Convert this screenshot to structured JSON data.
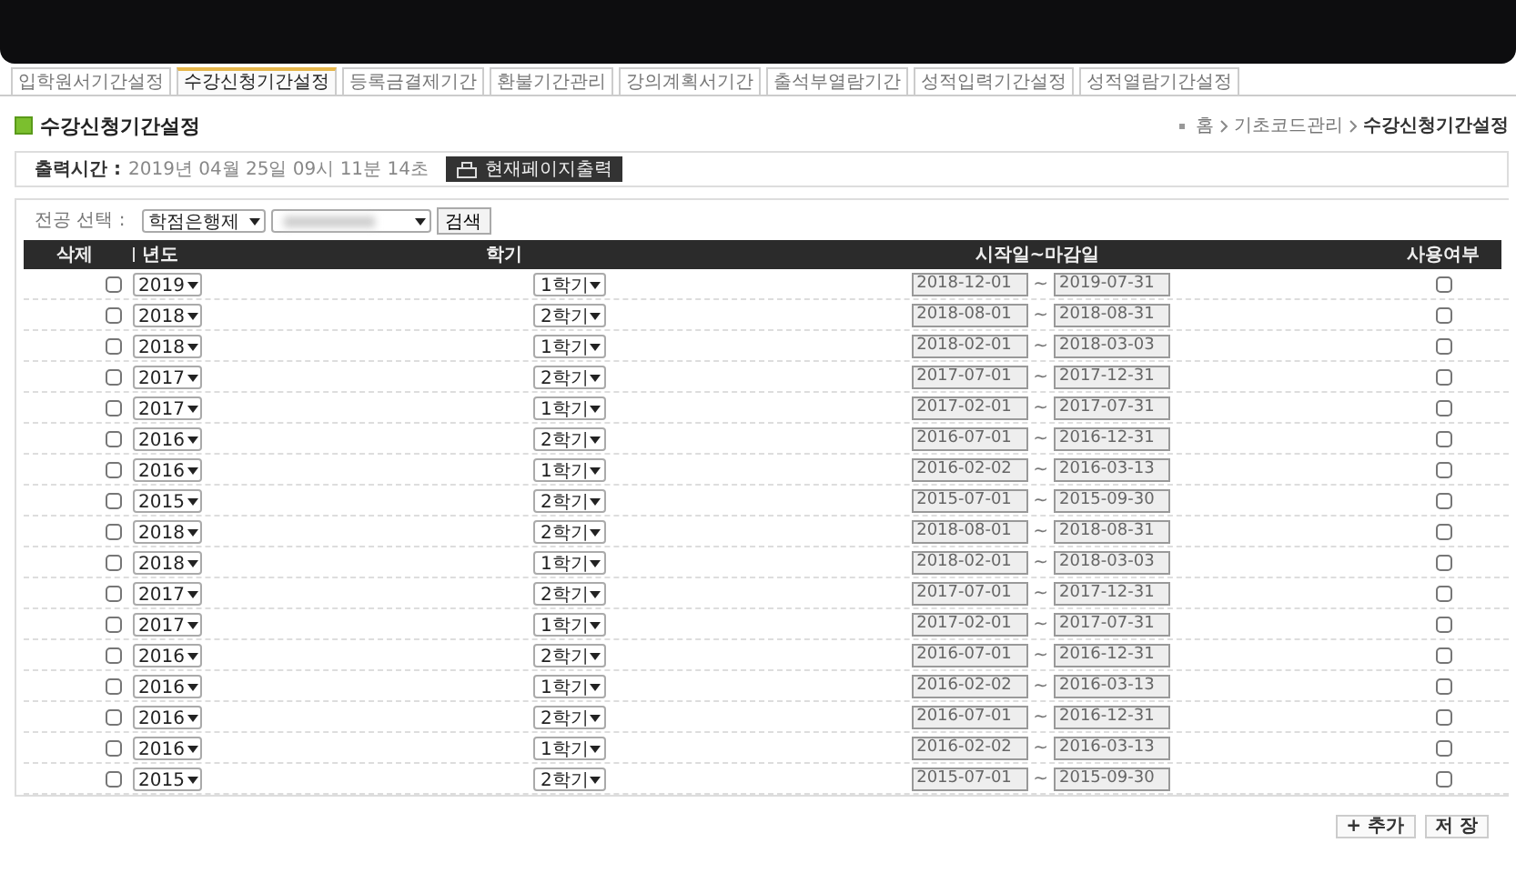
{
  "tabs": [
    {
      "label": "입학원서기간설정",
      "selected": false
    },
    {
      "label": "수강신청기간설정",
      "selected": true
    },
    {
      "label": "등록금결제기간",
      "selected": false
    },
    {
      "label": "환불기간관리",
      "selected": false
    },
    {
      "label": "강의계획서기간",
      "selected": false
    },
    {
      "label": "출석부열람기간",
      "selected": false
    },
    {
      "label": "성적입력기간설정",
      "selected": false
    },
    {
      "label": "성적열람기간설정",
      "selected": false
    }
  ],
  "page_title": "수강신청기간설정",
  "breadcrumb": [
    "홈",
    "기초코드관리",
    "수강신청기간설정"
  ],
  "print_info": {
    "label": "출력시간 :",
    "value": "2019년 04월 25일 09시 11분 14초",
    "button": "현재페이지출력"
  },
  "filter": {
    "label": "전공 선택 :",
    "major_select": "학점은행제",
    "detail_select": {
      "redacted": true
    },
    "search_button": "검색"
  },
  "table": {
    "columns": [
      "삭제",
      "년도",
      "학기",
      "시작일~마감일",
      "사용여부"
    ],
    "range_separator": "~",
    "rows": [
      {
        "delete": false,
        "year": "2019",
        "term": "1학기",
        "start": "2018-12-01",
        "end": "2019-07-31",
        "in_use": false
      },
      {
        "delete": false,
        "year": "2018",
        "term": "2학기",
        "start": "2018-08-01",
        "end": "2018-08-31",
        "in_use": false
      },
      {
        "delete": false,
        "year": "2018",
        "term": "1학기",
        "start": "2018-02-01",
        "end": "2018-03-03",
        "in_use": false
      },
      {
        "delete": false,
        "year": "2017",
        "term": "2학기",
        "start": "2017-07-01",
        "end": "2017-12-31",
        "in_use": false
      },
      {
        "delete": false,
        "year": "2017",
        "term": "1학기",
        "start": "2017-02-01",
        "end": "2017-07-31",
        "in_use": false
      },
      {
        "delete": false,
        "year": "2016",
        "term": "2학기",
        "start": "2016-07-01",
        "end": "2016-12-31",
        "in_use": false
      },
      {
        "delete": false,
        "year": "2016",
        "term": "1학기",
        "start": "2016-02-02",
        "end": "2016-03-13",
        "in_use": false
      },
      {
        "delete": false,
        "year": "2015",
        "term": "2학기",
        "start": "2015-07-01",
        "end": "2015-09-30",
        "in_use": false
      },
      {
        "delete": false,
        "year": "2018",
        "term": "2학기",
        "start": "2018-08-01",
        "end": "2018-08-31",
        "in_use": false
      },
      {
        "delete": false,
        "year": "2018",
        "term": "1학기",
        "start": "2018-02-01",
        "end": "2018-03-03",
        "in_use": false
      },
      {
        "delete": false,
        "year": "2017",
        "term": "2학기",
        "start": "2017-07-01",
        "end": "2017-12-31",
        "in_use": false
      },
      {
        "delete": false,
        "year": "2017",
        "term": "1학기",
        "start": "2017-02-01",
        "end": "2017-07-31",
        "in_use": false
      },
      {
        "delete": false,
        "year": "2016",
        "term": "2학기",
        "start": "2016-07-01",
        "end": "2016-12-31",
        "in_use": false
      },
      {
        "delete": false,
        "year": "2016",
        "term": "1학기",
        "start": "2016-02-02",
        "end": "2016-03-13",
        "in_use": false
      },
      {
        "delete": false,
        "year": "2016",
        "term": "2학기",
        "start": "2016-07-01",
        "end": "2016-12-31",
        "in_use": false
      },
      {
        "delete": false,
        "year": "2016",
        "term": "1학기",
        "start": "2016-02-02",
        "end": "2016-03-13",
        "in_use": false
      },
      {
        "delete": false,
        "year": "2015",
        "term": "2학기",
        "start": "2015-07-01",
        "end": "2015-09-30",
        "in_use": false
      }
    ]
  },
  "buttons": [
    "+ 추가",
    "저 장"
  ]
}
